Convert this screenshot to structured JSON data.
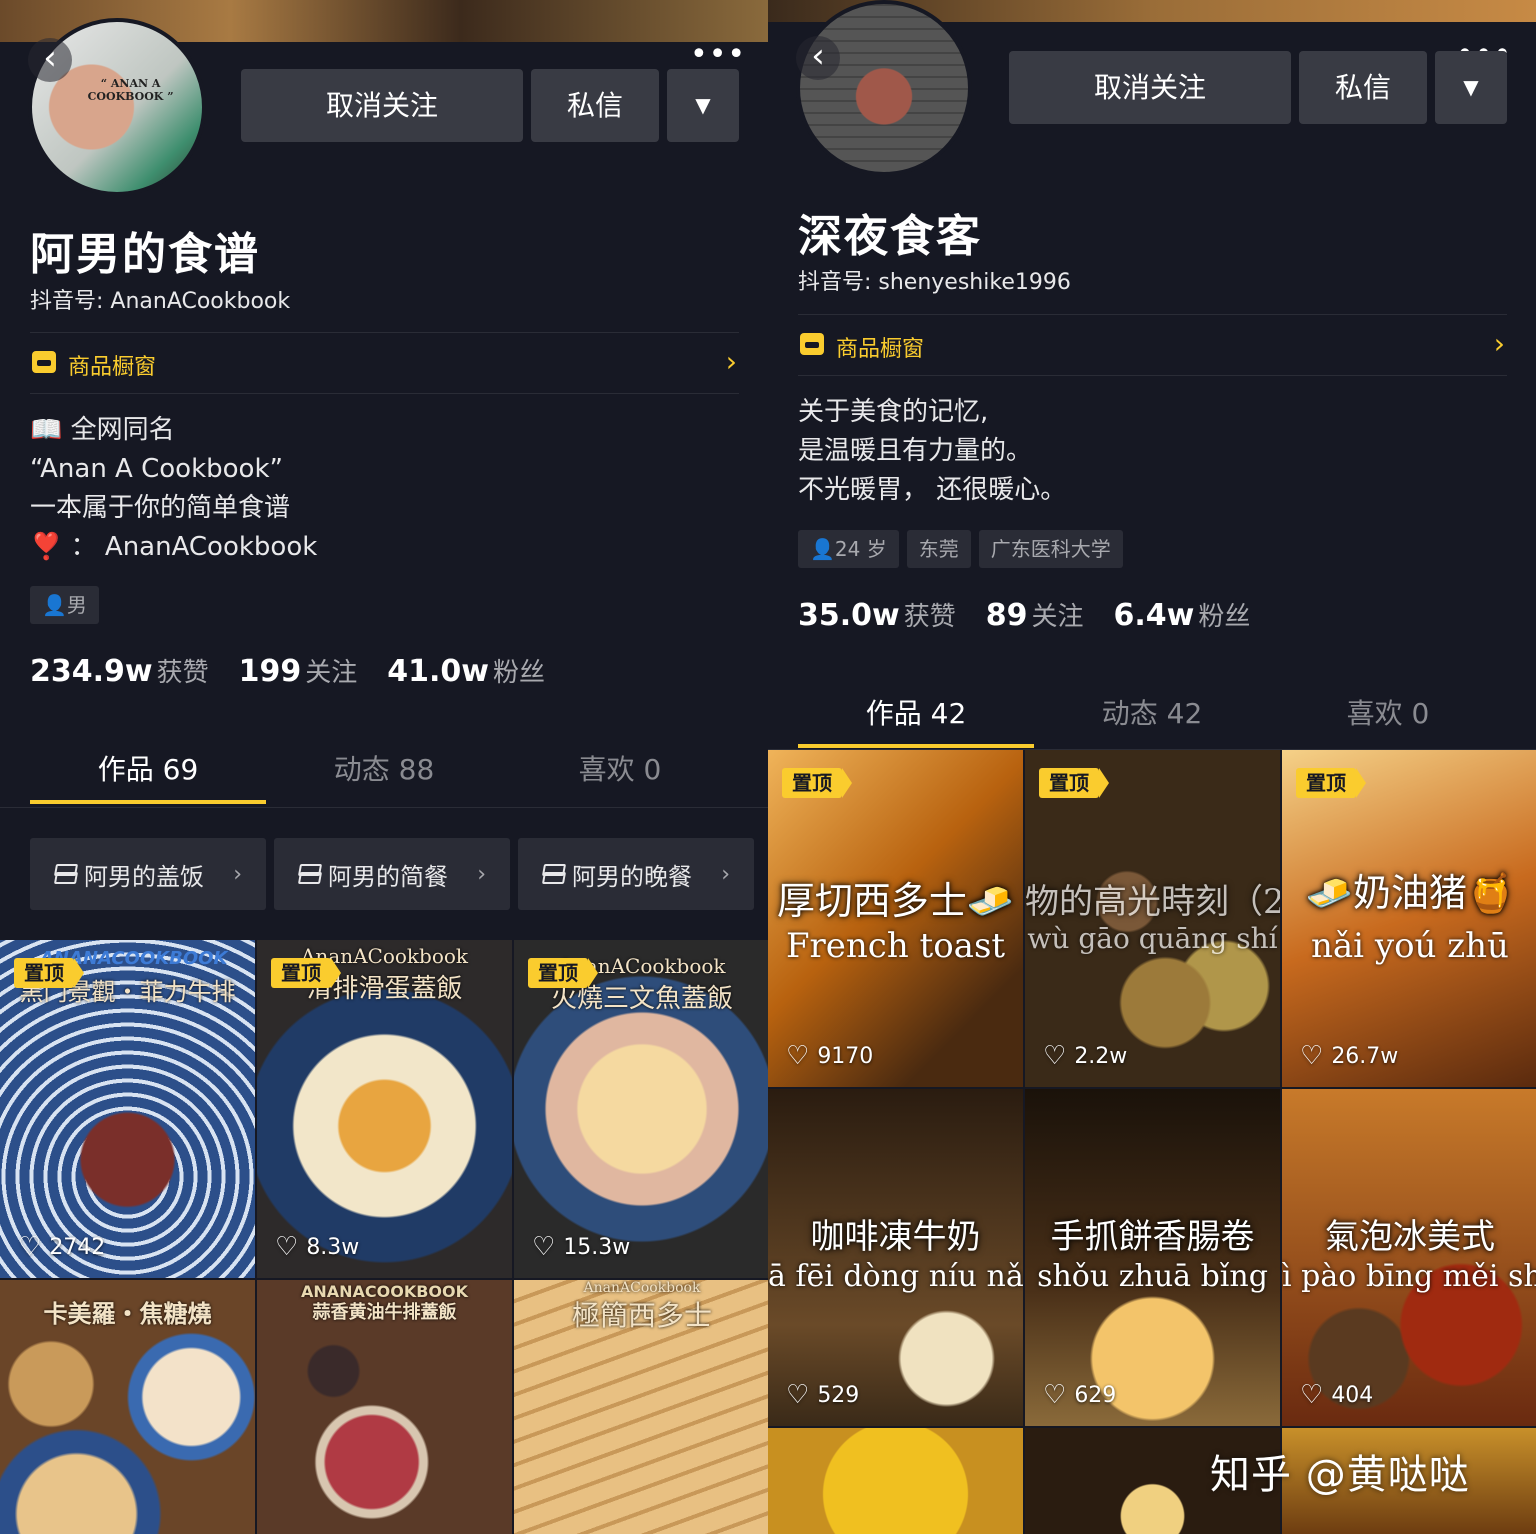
{
  "left": {
    "avatar_text": "“ ANAN A COOKBOOK ”",
    "back_icon": "‹",
    "more_icon": "•••",
    "buttons": {
      "unfollow": "取消关注",
      "message": "私信",
      "dropdown_icon": "▼"
    },
    "name": "阿男的食谱",
    "douyin_id": "抖音号: AnanACookbook",
    "shop": {
      "label": "商品橱窗",
      "chevron": "›"
    },
    "bio": [
      "📖 全网同名",
      "“Anan A Cookbook”",
      "一本属于你的简单食谱",
      "❣️ ： AnanACookbook"
    ],
    "tags": {
      "gender_icon": "👤",
      "gender": "男"
    },
    "stats": [
      {
        "num": "234.9w",
        "label": "获赞"
      },
      {
        "num": "199",
        "label": "关注"
      },
      {
        "num": "41.0w",
        "label": "粉丝"
      }
    ],
    "tabs": [
      {
        "label": "作品 69",
        "active": true
      },
      {
        "label": "动态 88",
        "active": false
      },
      {
        "label": "喜欢 0",
        "active": false
      }
    ],
    "collections": [
      {
        "label": "阿男的盖饭",
        "chevron": "›"
      },
      {
        "label": "阿男的简餐",
        "chevron": "›"
      },
      {
        "label": "阿男的晚餐",
        "chevron": "›"
      }
    ],
    "videos": [
      {
        "pinned": "置顶",
        "title": "黑门景觀・菲力牛排",
        "brand": "ANANACOOKBOOK",
        "likes": "2742"
      },
      {
        "pinned": "置顶",
        "title": "滑排滑蛋蓋飯",
        "brand": "AnanACookbook",
        "likes": "8.3w"
      },
      {
        "pinned": "置顶",
        "title": "火燒三文魚蓋飯",
        "brand": "AnanACookbook",
        "likes": "15.3w"
      },
      {
        "title": "卡美羅・焦糖燒",
        "likes": ""
      },
      {
        "title": "蒜香黄油牛排蓋飯",
        "brand": "ANANACOOKBOOK",
        "likes": ""
      },
      {
        "title": "極簡西多士",
        "brand": "AnanACookbook",
        "likes": ""
      }
    ]
  },
  "right": {
    "back_icon": "‹",
    "more_icon": "•••",
    "buttons": {
      "unfollow": "取消关注",
      "message": "私信",
      "dropdown_icon": "▼"
    },
    "name": "深夜食客",
    "douyin_id": "抖音号: shenyeshike1996",
    "shop": {
      "label": "商品橱窗",
      "chevron": "›"
    },
    "bio": [
      "关于美食的记忆,",
      "是温暖且有力量的。",
      "不光暖胃， 还很暖心。"
    ],
    "tags": {
      "gender_icon": "👤",
      "age": "24 岁",
      "city": "东莞",
      "school": "广东医科大学"
    },
    "stats": [
      {
        "num": "35.0w",
        "label": "获赞"
      },
      {
        "num": "89",
        "label": "关注"
      },
      {
        "num": "6.4w",
        "label": "粉丝"
      }
    ],
    "tabs": [
      {
        "label": "作品 42",
        "active": true
      },
      {
        "label": "动态 42",
        "active": false
      },
      {
        "label": "喜欢 0",
        "active": false
      }
    ],
    "videos": [
      {
        "pinned": "置顶",
        "title": "厚切西多士🧈",
        "sub": "French toast",
        "likes": "9170"
      },
      {
        "pinned": "置顶",
        "title": "物的高光時刻（2",
        "sub": "wù gāo quāng shí",
        "likes": "2.2w"
      },
      {
        "pinned": "置顶",
        "title": "🧈奶油猪🍯",
        "sub": "nǎi yoú zhū",
        "likes": "26.7w"
      },
      {
        "title": "咖啡凍牛奶",
        "sub": "ā fēi dòng níu nǎ",
        "likes": "529"
      },
      {
        "title": "手抓餅香腸卷",
        "sub": "shǒu zhuā bǐng",
        "likes": "629"
      },
      {
        "title": "氣泡冰美式",
        "sub": "ì pào bīng měi sh",
        "likes": "404"
      },
      {
        "title": "",
        "likes": ""
      },
      {
        "title": "",
        "likes": ""
      },
      {
        "title": "",
        "likes": ""
      }
    ]
  },
  "watermark": "知乎 @黄哒哒",
  "colors": {
    "background": "#161823",
    "accent": "#facc2e",
    "button": "#393b44",
    "muted": "#a8a9ae"
  },
  "icons": {
    "heart": "♡"
  }
}
